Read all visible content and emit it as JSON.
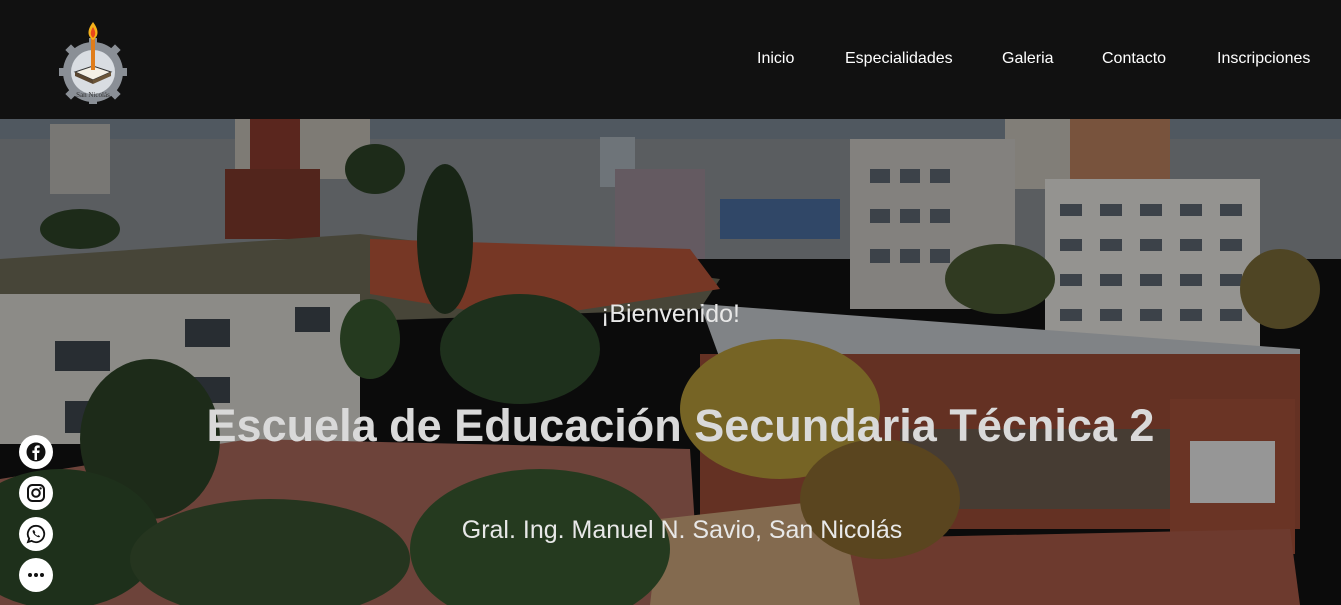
{
  "nav": {
    "items": [
      "Inicio",
      "Especialidades",
      "Galeria",
      "Contacto",
      "Inscripciones"
    ]
  },
  "logo": {
    "text": "San Nicolás"
  },
  "hero": {
    "welcome": "¡Bienvenido!",
    "title": "Escuela de Educación Secundaria Técnica 2",
    "subtitle": "Gral. Ing. Manuel N. Savio, San Nicolás"
  },
  "social": {
    "icons": [
      "facebook-icon",
      "instagram-icon",
      "whatsapp-icon",
      "more-icon"
    ]
  },
  "colors": {
    "navbar": "#111111",
    "nav_text": "#ffffff",
    "hero_text": "#d9d9d9"
  }
}
